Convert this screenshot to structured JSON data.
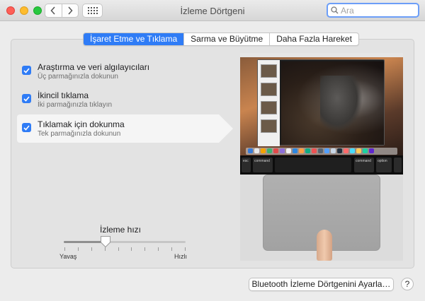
{
  "window": {
    "title": "İzleme Dörtgeni"
  },
  "search": {
    "placeholder": "Ara"
  },
  "tabs": [
    {
      "label": "İşaret Etme ve Tıklama",
      "active": true
    },
    {
      "label": "Sarma ve Büyütme",
      "active": false
    },
    {
      "label": "Daha Fazla Hareket",
      "active": false
    }
  ],
  "options": [
    {
      "title": "Araştırma ve veri algılayıcıları",
      "subtitle": "Üç parmağınızla dokunun",
      "checked": true,
      "selected": false
    },
    {
      "title": "İkincil tıklama",
      "subtitle": "İki parmağınızla tıklayın",
      "checked": true,
      "selected": false
    },
    {
      "title": "Tıklamak için dokunma",
      "subtitle": "Tek parmağınızla dokunun",
      "checked": true,
      "selected": true
    }
  ],
  "tracking_speed": {
    "label": "İzleme hızı",
    "min_label": "Yavaş",
    "max_label": "Hızlı",
    "value_fraction": 0.345,
    "tick_count": 10
  },
  "preview": {
    "touchbar_keys": [
      "esc",
      "command",
      "command",
      "option"
    ]
  },
  "buttons": {
    "bluetooth": "Bluetooth İzleme Dörtgenini Ayarla…",
    "help": "?"
  },
  "colors": {
    "accent": "#2f7cf6",
    "close": "#fe5f57",
    "minimize": "#febc2e",
    "maximize": "#28c840"
  }
}
